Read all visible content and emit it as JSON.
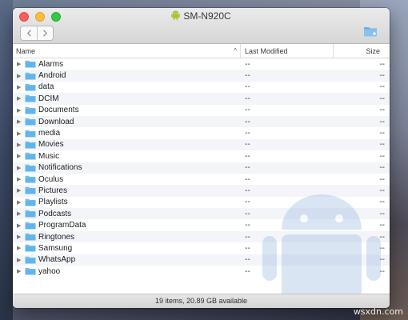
{
  "window": {
    "title": "SM-N920C",
    "title_icon": "android-icon",
    "back_icon": "chevron-left-icon",
    "forward_icon": "chevron-right-icon",
    "new_folder_icon": "new-folder-icon"
  },
  "columns": {
    "name": "Name",
    "last_modified": "Last Modified",
    "size": "Size",
    "sort_indicator": "^"
  },
  "rows": [
    {
      "name": "Alarms",
      "modified": "--",
      "size": "--"
    },
    {
      "name": "Android",
      "modified": "--",
      "size": "--"
    },
    {
      "name": "data",
      "modified": "--",
      "size": "--"
    },
    {
      "name": "DCIM",
      "modified": "--",
      "size": "--"
    },
    {
      "name": "Documents",
      "modified": "--",
      "size": "--"
    },
    {
      "name": "Download",
      "modified": "--",
      "size": "--"
    },
    {
      "name": "media",
      "modified": "--",
      "size": "--"
    },
    {
      "name": "Movies",
      "modified": "--",
      "size": "--"
    },
    {
      "name": "Music",
      "modified": "--",
      "size": "--"
    },
    {
      "name": "Notifications",
      "modified": "--",
      "size": "--"
    },
    {
      "name": "Oculus",
      "modified": "--",
      "size": "--"
    },
    {
      "name": "Pictures",
      "modified": "--",
      "size": "--"
    },
    {
      "name": "Playlists",
      "modified": "--",
      "size": "--"
    },
    {
      "name": "Podcasts",
      "modified": "--",
      "size": "--"
    },
    {
      "name": "ProgramData",
      "modified": "--",
      "size": "--"
    },
    {
      "name": "Ringtones",
      "modified": "--",
      "size": "--"
    },
    {
      "name": "Samsung",
      "modified": "--",
      "size": "--"
    },
    {
      "name": "WhatsApp",
      "modified": "--",
      "size": "--"
    },
    {
      "name": "yahoo",
      "modified": "--",
      "size": "--"
    }
  ],
  "status": "19 items, 20.89 GB available",
  "watermark": "wsxdn.com",
  "colors": {
    "folder": "#62b5ec",
    "android": "#a4c639"
  }
}
